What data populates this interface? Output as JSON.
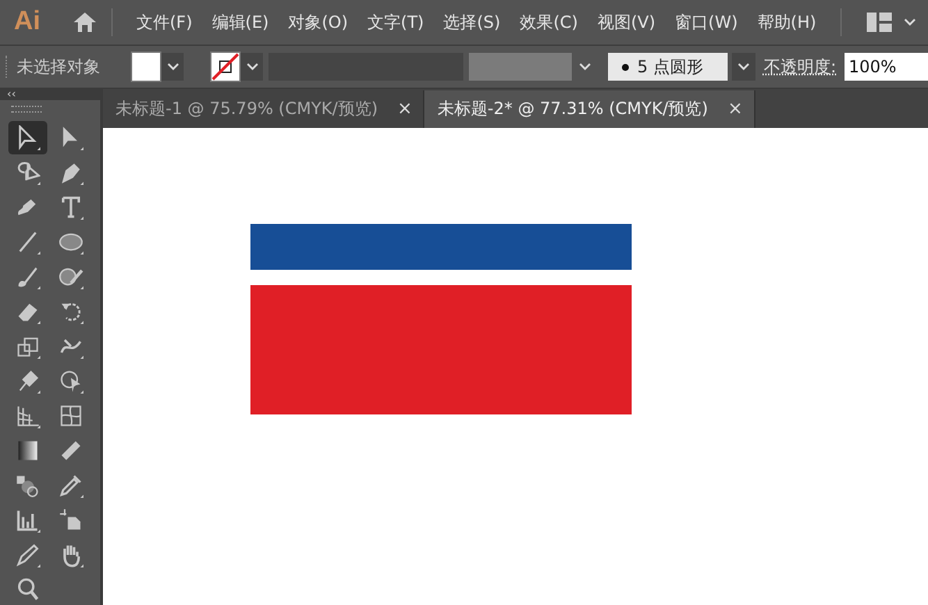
{
  "app": {
    "logo": "Ai"
  },
  "menu": [
    "文件(F)",
    "编辑(E)",
    "对象(O)",
    "文字(T)",
    "选择(S)",
    "效果(C)",
    "视图(V)",
    "窗口(W)",
    "帮助(H)"
  ],
  "control_bar": {
    "selection": "未选择对象",
    "brush": "5 点圆形",
    "opacity_label": "不透明度:",
    "opacity": "100%"
  },
  "tabs": [
    {
      "label": "未标题-1 @ 75.79% (CMYK/预览)",
      "selected": false,
      "close": "×"
    },
    {
      "label": "未标题-2* @ 77.31% (CMYK/预览)",
      "selected": true,
      "close": "×"
    }
  ],
  "toolbar": {
    "collapse": "‹‹",
    "tools": [
      {
        "selected": true
      },
      {
        "selected": false
      },
      {
        "selected": false
      },
      {
        "selected": false
      },
      {
        "selected": false
      },
      {
        "selected": false
      },
      {
        "selected": false
      },
      {
        "selected": false
      },
      {
        "selected": false
      },
      {
        "selected": false
      },
      {
        "selected": false
      },
      {
        "selected": false
      },
      {
        "selected": false
      },
      {
        "selected": false
      },
      {
        "selected": false
      },
      {
        "selected": false
      },
      {
        "selected": false
      },
      {
        "selected": false
      },
      {
        "selected": false
      },
      {
        "selected": false
      },
      {
        "selected": false
      },
      {
        "selected": false
      },
      {
        "selected": false
      },
      {
        "selected": false
      },
      {
        "selected": false
      },
      {
        "selected": false
      },
      {
        "selected": false
      }
    ]
  },
  "artboard": {
    "shapes": [
      {
        "color": "#174e96"
      },
      {
        "color": "#e01f26"
      }
    ]
  }
}
